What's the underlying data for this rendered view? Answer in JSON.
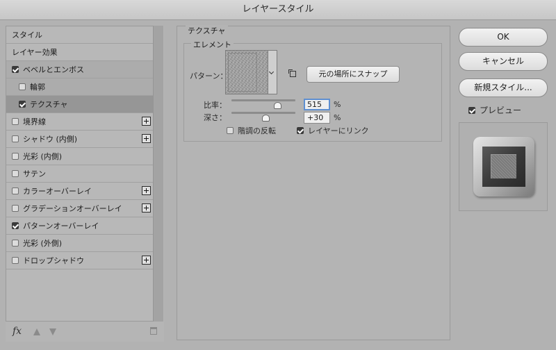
{
  "window": {
    "title": "レイヤースタイル"
  },
  "styles_list": [
    {
      "label": "スタイル",
      "type": "plain"
    },
    {
      "label": "レイヤー効果",
      "type": "plain"
    },
    {
      "label": "ベベルとエンボス",
      "type": "check",
      "checked": true
    },
    {
      "label": "輪郭",
      "type": "check",
      "checked": false,
      "indent": true
    },
    {
      "label": "テクスチャ",
      "type": "check",
      "checked": true,
      "indent": true,
      "selected": true
    },
    {
      "label": "境界線",
      "type": "check",
      "checked": false,
      "plus": true
    },
    {
      "label": "シャドウ (内側)",
      "type": "check",
      "checked": false,
      "plus": true
    },
    {
      "label": "光彩 (内側)",
      "type": "check",
      "checked": false
    },
    {
      "label": "サテン",
      "type": "check",
      "checked": false
    },
    {
      "label": "カラーオーバーレイ",
      "type": "check",
      "checked": false,
      "plus": true
    },
    {
      "label": "グラデーションオーバーレイ",
      "type": "check",
      "checked": false,
      "plus": true
    },
    {
      "label": "パターンオーバーレイ",
      "type": "check",
      "checked": true
    },
    {
      "label": "光彩 (外側)",
      "type": "check",
      "checked": false
    },
    {
      "label": "ドロップシャドウ",
      "type": "check",
      "checked": false,
      "plus": true
    }
  ],
  "footer": {
    "fx_label": "fx"
  },
  "texture": {
    "section_title": "テクスチャ",
    "group_title": "エレメント",
    "pattern_label": "パターン：",
    "snap_button": "元の場所にスナップ",
    "scale_label": "比率：",
    "scale_value": "515",
    "scale_unit": "%",
    "scale_slider_fraction": 0.72,
    "depth_label": "深さ：",
    "depth_value": "+30",
    "depth_unit": "%",
    "depth_slider_fraction": 0.53,
    "invert_label": "階調の反転",
    "invert_checked": false,
    "link_label": "レイヤーにリンク",
    "link_checked": true
  },
  "actions": {
    "ok": "OK",
    "cancel": "キャンセル",
    "new_style": "新規スタイル...",
    "preview_label": "プレビュー",
    "preview_checked": true
  }
}
